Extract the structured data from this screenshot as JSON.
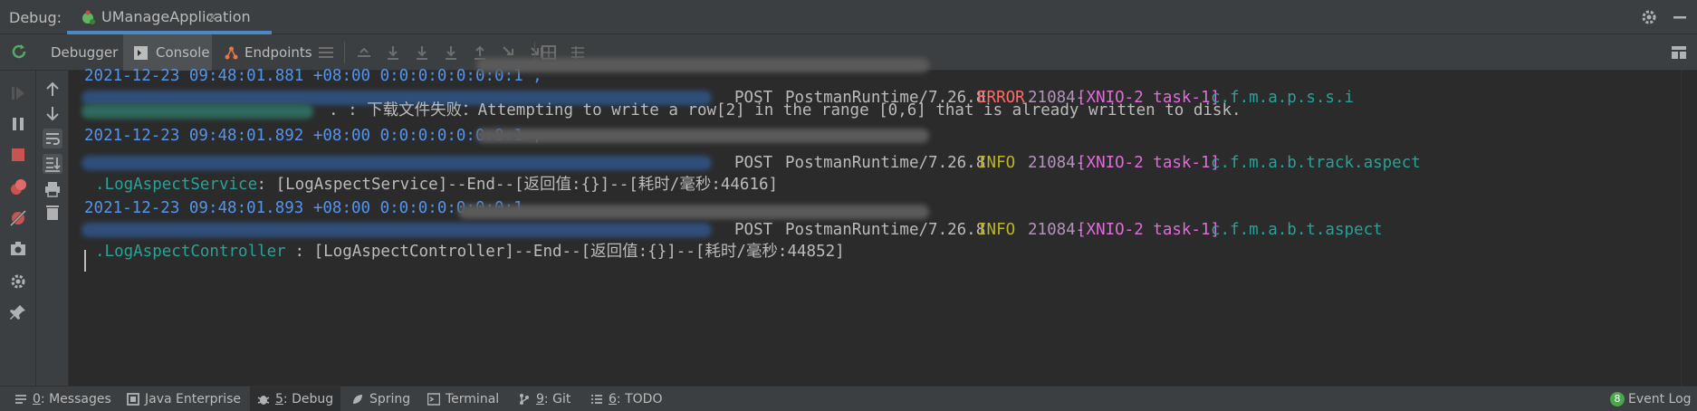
{
  "header": {
    "debug_label": "Debug:",
    "session_name": "UManageApplication",
    "close_glyph": "×"
  },
  "toolbar": {
    "tabs": [
      {
        "label": "Debugger",
        "icon": "debugger-icon",
        "active": false
      },
      {
        "label": "Console",
        "icon": "console-icon",
        "active": true
      },
      {
        "label": "Endpoints",
        "icon": "endpoints-icon",
        "active": false
      }
    ]
  },
  "console": {
    "lines": [
      {
        "text": "2021-12-23 09:48:01.881 +08:00 0:0:0:0:0:0:0:1 ,"
      },
      {
        "method": "POST",
        "agent": "PostmanRuntime/7.26.8",
        "level": "ERROR",
        "pid": "21084-",
        "thread": "[XNIO-2 task-1]",
        "logger": "c.f.m.a.p.s.s.i"
      },
      {
        "text": ". : 下载文件失败：Attempting to write a row[2] in the range [0,6] that is already written to disk."
      },
      {
        "text": "2021-12-23 09:48:01.892 +08:00 0:0:0:0:0:0:0:1 ,"
      },
      {
        "method": "POST",
        "agent": "PostmanRuntime/7.26.8",
        "level": "INFO",
        "pid": "21084-",
        "thread": "[XNIO-2 task-1]",
        "logger": "c.f.m.a.b.track.aspect"
      },
      {
        "logger_cont": ".LogAspectService",
        "text": " : [LogAspectService]--End--[返回值:{}]--[耗时/毫秒:44616]"
      },
      {
        "text": "2021-12-23 09:48:01.893 +08:00 0:0:0:0:0:0:0:1"
      },
      {
        "method": "POST",
        "agent": "PostmanRuntime/7.26.8",
        "level": "INFO",
        "pid": "21084-",
        "thread": "[XNIO-2 task-1]",
        "logger": "c.f.m.a.b.t.aspect"
      },
      {
        "logger_cont": ".LogAspectController",
        "text": " : [LogAspectController]--End--[返回值:{}]--[耗时/毫秒:44852]"
      }
    ]
  },
  "statusbar": {
    "items": [
      {
        "num": "0",
        "label": ": Messages",
        "icon": "messages-icon"
      },
      {
        "label": "Java Enterprise",
        "icon": "java-enterprise-icon"
      },
      {
        "num": "5",
        "label": ": Debug",
        "icon": "debug-icon",
        "active": true
      },
      {
        "label": "Spring",
        "icon": "spring-icon"
      },
      {
        "label": "Terminal",
        "icon": "terminal-icon"
      },
      {
        "num": "9",
        "label": ": Git",
        "icon": "git-icon"
      },
      {
        "num": "6",
        "label": ": TODO",
        "icon": "todo-icon"
      }
    ],
    "event_log": {
      "badge": "8",
      "label": "Event Log"
    }
  },
  "colors": {
    "accent": "#4a88c7",
    "timestamp": "#5394ec",
    "error": "#ff6b68",
    "info": "#bbb529",
    "thread": "#e06cd9",
    "logger": "#2aa198"
  }
}
